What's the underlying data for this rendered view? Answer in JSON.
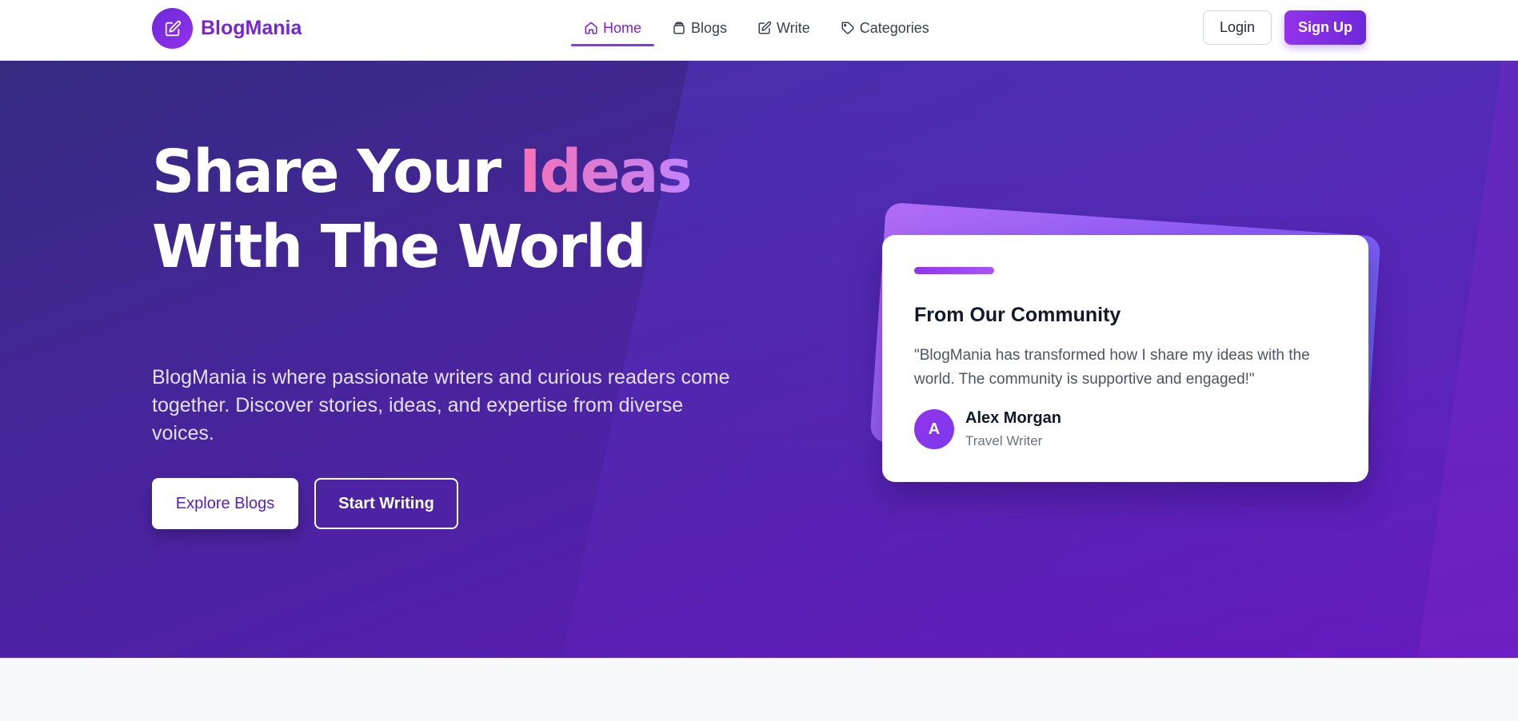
{
  "brand": {
    "name": "BlogMania",
    "logo_icon": "edit-icon"
  },
  "nav": {
    "items": [
      {
        "label": "Home",
        "icon": "home-icon",
        "active": true
      },
      {
        "label": "Blogs",
        "icon": "book-icon",
        "active": false
      },
      {
        "label": "Write",
        "icon": "edit-icon",
        "active": false
      },
      {
        "label": "Categories",
        "icon": "tag-icon",
        "active": false
      }
    ],
    "login_label": "Login",
    "signup_label": "Sign Up"
  },
  "hero": {
    "title_part1": "Share Your ",
    "title_highlight": "Ideas",
    "title_line2": "With The World",
    "description": "BlogMania is where passionate writers and curious readers come together. Discover stories, ideas, and expertise from diverse voices.",
    "explore_label": "Explore Blogs",
    "write_label": "Start Writing"
  },
  "testimonial": {
    "title": "From Our Community",
    "quote": "\"BlogMania has transformed how I share my ideas with the world. The community is supportive and engaged!\"",
    "avatar_initial": "A",
    "author_name": "Alex Morgan",
    "author_role": "Travel Writer"
  },
  "colors": {
    "accent": "#7c3aed",
    "hero_start": "#352a80",
    "hero_end": "#6418bd",
    "highlight_start": "#f472b6",
    "highlight_end": "#c084fc"
  }
}
